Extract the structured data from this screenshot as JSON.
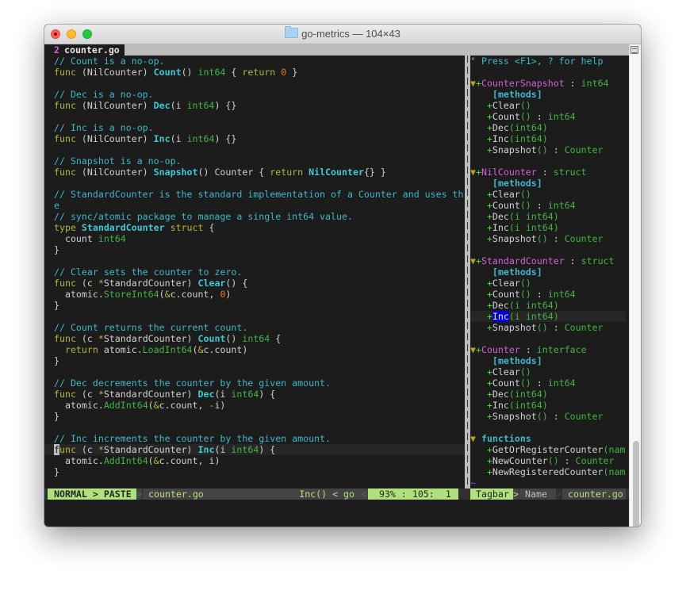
{
  "window": {
    "title": "go-metrics — 104×43",
    "folder_icon": "folder-icon"
  },
  "tabline": {
    "tab_number": "2",
    "tab_name": "counter.go"
  },
  "editor": {
    "lines": [
      [
        {
          "t": "// Count is a no-op.",
          "c": "c-comment"
        }
      ],
      [
        {
          "t": "func",
          "c": "c-kw"
        },
        {
          "t": " (NilCounter) ",
          "c": "c-text"
        },
        {
          "t": "Count",
          "c": "c-fn"
        },
        {
          "t": "() ",
          "c": "c-text"
        },
        {
          "t": "int64",
          "c": "c-type"
        },
        {
          "t": " { ",
          "c": "c-text"
        },
        {
          "t": "return",
          "c": "c-kw"
        },
        {
          "t": " ",
          "c": "c-text"
        },
        {
          "t": "0",
          "c": "c-num"
        },
        {
          "t": " }",
          "c": "c-text"
        }
      ],
      [],
      [
        {
          "t": "// Dec is a no-op.",
          "c": "c-comment"
        }
      ],
      [
        {
          "t": "func",
          "c": "c-kw"
        },
        {
          "t": " (NilCounter) ",
          "c": "c-text"
        },
        {
          "t": "Dec",
          "c": "c-fn"
        },
        {
          "t": "(i ",
          "c": "c-text"
        },
        {
          "t": "int64",
          "c": "c-type"
        },
        {
          "t": ") {}",
          "c": "c-text"
        }
      ],
      [],
      [
        {
          "t": "// Inc is a no-op.",
          "c": "c-comment"
        }
      ],
      [
        {
          "t": "func",
          "c": "c-kw"
        },
        {
          "t": " (NilCounter) ",
          "c": "c-text"
        },
        {
          "t": "Inc",
          "c": "c-fn"
        },
        {
          "t": "(i ",
          "c": "c-text"
        },
        {
          "t": "int64",
          "c": "c-type"
        },
        {
          "t": ") {}",
          "c": "c-text"
        }
      ],
      [],
      [
        {
          "t": "// Snapshot is a no-op.",
          "c": "c-comment"
        }
      ],
      [
        {
          "t": "func",
          "c": "c-kw"
        },
        {
          "t": " (NilCounter) ",
          "c": "c-text"
        },
        {
          "t": "Snapshot",
          "c": "c-fn"
        },
        {
          "t": "() Counter { ",
          "c": "c-text"
        },
        {
          "t": "return",
          "c": "c-kw"
        },
        {
          "t": " ",
          "c": "c-text"
        },
        {
          "t": "NilCounter",
          "c": "c-fn"
        },
        {
          "t": "{} }",
          "c": "c-text"
        }
      ],
      [],
      [
        {
          "t": "// StandardCounter is the standard implementation of a Counter and uses th",
          "c": "c-comment"
        }
      ],
      [
        {
          "t": "e",
          "c": "c-comment"
        }
      ],
      [
        {
          "t": "// sync/atomic package to manage a single int64 value.",
          "c": "c-comment"
        }
      ],
      [
        {
          "t": "type",
          "c": "c-kw"
        },
        {
          "t": " ",
          "c": "c-text"
        },
        {
          "t": "StandardCounter",
          "c": "c-fn"
        },
        {
          "t": " ",
          "c": "c-text"
        },
        {
          "t": "struct",
          "c": "c-kw"
        },
        {
          "t": " {",
          "c": "c-text"
        }
      ],
      [
        {
          "t": "  count ",
          "c": "c-text"
        },
        {
          "t": "int64",
          "c": "c-type"
        }
      ],
      [
        {
          "t": "}",
          "c": "c-text"
        }
      ],
      [],
      [
        {
          "t": "// Clear sets the counter to zero.",
          "c": "c-comment"
        }
      ],
      [
        {
          "t": "func",
          "c": "c-kw"
        },
        {
          "t": " (c ",
          "c": "c-text"
        },
        {
          "t": "*",
          "c": "c-ptr"
        },
        {
          "t": "StandardCounter) ",
          "c": "c-text"
        },
        {
          "t": "Clear",
          "c": "c-fn"
        },
        {
          "t": "() {",
          "c": "c-text"
        }
      ],
      [
        {
          "t": "  atomic.",
          "c": "c-text"
        },
        {
          "t": "StoreInt64",
          "c": "c-call"
        },
        {
          "t": "(",
          "c": "c-text"
        },
        {
          "t": "&",
          "c": "c-ptr"
        },
        {
          "t": "c.count, ",
          "c": "c-text"
        },
        {
          "t": "0",
          "c": "c-num"
        },
        {
          "t": ")",
          "c": "c-text"
        }
      ],
      [
        {
          "t": "}",
          "c": "c-text"
        }
      ],
      [],
      [
        {
          "t": "// Count returns the current count.",
          "c": "c-comment"
        }
      ],
      [
        {
          "t": "func",
          "c": "c-kw"
        },
        {
          "t": " (c ",
          "c": "c-text"
        },
        {
          "t": "*",
          "c": "c-ptr"
        },
        {
          "t": "StandardCounter) ",
          "c": "c-text"
        },
        {
          "t": "Count",
          "c": "c-fn"
        },
        {
          "t": "() ",
          "c": "c-text"
        },
        {
          "t": "int64",
          "c": "c-type"
        },
        {
          "t": " {",
          "c": "c-text"
        }
      ],
      [
        {
          "t": "  ",
          "c": "c-text"
        },
        {
          "t": "return",
          "c": "c-kw"
        },
        {
          "t": " atomic.",
          "c": "c-text"
        },
        {
          "t": "LoadInt64",
          "c": "c-call"
        },
        {
          "t": "(",
          "c": "c-text"
        },
        {
          "t": "&",
          "c": "c-ptr"
        },
        {
          "t": "c.count)",
          "c": "c-text"
        }
      ],
      [
        {
          "t": "}",
          "c": "c-text"
        }
      ],
      [],
      [
        {
          "t": "// Dec decrements the counter by the given amount.",
          "c": "c-comment"
        }
      ],
      [
        {
          "t": "func",
          "c": "c-kw"
        },
        {
          "t": " (c ",
          "c": "c-text"
        },
        {
          "t": "*",
          "c": "c-ptr"
        },
        {
          "t": "StandardCounter) ",
          "c": "c-text"
        },
        {
          "t": "Dec",
          "c": "c-fn"
        },
        {
          "t": "(i ",
          "c": "c-text"
        },
        {
          "t": "int64",
          "c": "c-type"
        },
        {
          "t": ") {",
          "c": "c-text"
        }
      ],
      [
        {
          "t": "  atomic.",
          "c": "c-text"
        },
        {
          "t": "AddInt64",
          "c": "c-call"
        },
        {
          "t": "(",
          "c": "c-text"
        },
        {
          "t": "&",
          "c": "c-ptr"
        },
        {
          "t": "c.count, ",
          "c": "c-text"
        },
        {
          "t": "-",
          "c": "c-ptr"
        },
        {
          "t": "i)",
          "c": "c-text"
        }
      ],
      [
        {
          "t": "}",
          "c": "c-text"
        }
      ],
      [],
      [
        {
          "t": "// Inc increments the counter by the given amount.",
          "c": "c-comment"
        }
      ],
      [
        {
          "t": "f",
          "c": "cursor-block"
        },
        {
          "t": "unc",
          "c": "c-kw"
        },
        {
          "t": " (c ",
          "c": "c-text"
        },
        {
          "t": "*",
          "c": "c-ptr"
        },
        {
          "t": "StandardCounter) ",
          "c": "c-text"
        },
        {
          "t": "Inc",
          "c": "c-fn"
        },
        {
          "t": "(i ",
          "c": "c-text"
        },
        {
          "t": "int64",
          "c": "c-type"
        },
        {
          "t": ") {",
          "c": "c-text"
        }
      ],
      [
        {
          "t": "  atomic.",
          "c": "c-text"
        },
        {
          "t": "AddInt64",
          "c": "c-call"
        },
        {
          "t": "(",
          "c": "c-text"
        },
        {
          "t": "&",
          "c": "c-ptr"
        },
        {
          "t": "c.count, i)",
          "c": "c-text"
        }
      ],
      [
        {
          "t": "}",
          "c": "c-text"
        }
      ]
    ],
    "cursor_line_index": 35
  },
  "tagbar": {
    "lines": [
      [
        {
          "t": "\" Press <F1>, ? for help",
          "c": "t-help"
        }
      ],
      [],
      [
        {
          "t": "▼",
          "c": "t-fold"
        },
        {
          "t": "+",
          "c": "t-plus"
        },
        {
          "t": "CounterSnapshot",
          "c": "t-scope"
        },
        {
          "t": " : ",
          "c": "t-name"
        },
        {
          "t": "int64",
          "c": "t-sig"
        }
      ],
      [
        {
          "t": "    [methods]",
          "c": "t-kind"
        }
      ],
      [
        {
          "t": "   +",
          "c": "t-plus"
        },
        {
          "t": "Clear",
          "c": "t-name"
        },
        {
          "t": "()",
          "c": "t-sig"
        }
      ],
      [
        {
          "t": "   +",
          "c": "t-plus"
        },
        {
          "t": "Count",
          "c": "t-name"
        },
        {
          "t": "()",
          "c": "t-sig"
        },
        {
          "t": " : ",
          "c": "t-name"
        },
        {
          "t": "int64",
          "c": "t-sig"
        }
      ],
      [
        {
          "t": "   +",
          "c": "t-plus"
        },
        {
          "t": "Dec",
          "c": "t-name"
        },
        {
          "t": "(int64)",
          "c": "t-sig"
        }
      ],
      [
        {
          "t": "   +",
          "c": "t-plus"
        },
        {
          "t": "Inc",
          "c": "t-name"
        },
        {
          "t": "(int64)",
          "c": "t-sig"
        }
      ],
      [
        {
          "t": "   +",
          "c": "t-plus"
        },
        {
          "t": "Snapshot",
          "c": "t-name"
        },
        {
          "t": "()",
          "c": "t-sig"
        },
        {
          "t": " : ",
          "c": "t-name"
        },
        {
          "t": "Counter",
          "c": "t-sig"
        }
      ],
      [],
      [
        {
          "t": "▼",
          "c": "t-fold"
        },
        {
          "t": "+",
          "c": "t-plus"
        },
        {
          "t": "NilCounter",
          "c": "t-scope"
        },
        {
          "t": " : ",
          "c": "t-name"
        },
        {
          "t": "struct",
          "c": "t-sig"
        }
      ],
      [
        {
          "t": "    [methods]",
          "c": "t-kind"
        }
      ],
      [
        {
          "t": "   +",
          "c": "t-plus"
        },
        {
          "t": "Clear",
          "c": "t-name"
        },
        {
          "t": "()",
          "c": "t-sig"
        }
      ],
      [
        {
          "t": "   +",
          "c": "t-plus"
        },
        {
          "t": "Count",
          "c": "t-name"
        },
        {
          "t": "()",
          "c": "t-sig"
        },
        {
          "t": " : ",
          "c": "t-name"
        },
        {
          "t": "int64",
          "c": "t-sig"
        }
      ],
      [
        {
          "t": "   +",
          "c": "t-plus"
        },
        {
          "t": "Dec",
          "c": "t-name"
        },
        {
          "t": "(i int64)",
          "c": "t-sig"
        }
      ],
      [
        {
          "t": "   +",
          "c": "t-plus"
        },
        {
          "t": "Inc",
          "c": "t-name"
        },
        {
          "t": "(i int64)",
          "c": "t-sig"
        }
      ],
      [
        {
          "t": "   +",
          "c": "t-plus"
        },
        {
          "t": "Snapshot",
          "c": "t-name"
        },
        {
          "t": "()",
          "c": "t-sig"
        },
        {
          "t": " : ",
          "c": "t-name"
        },
        {
          "t": "Counter",
          "c": "t-sig"
        }
      ],
      [],
      [
        {
          "t": "▼",
          "c": "t-fold"
        },
        {
          "t": "+",
          "c": "t-plus"
        },
        {
          "t": "StandardCounter",
          "c": "t-scope"
        },
        {
          "t": " : ",
          "c": "t-name"
        },
        {
          "t": "struct",
          "c": "t-sig"
        }
      ],
      [
        {
          "t": "    [methods]",
          "c": "t-kind"
        }
      ],
      [
        {
          "t": "   +",
          "c": "t-plus"
        },
        {
          "t": "Clear",
          "c": "t-name"
        },
        {
          "t": "()",
          "c": "t-sig"
        }
      ],
      [
        {
          "t": "   +",
          "c": "t-plus"
        },
        {
          "t": "Count",
          "c": "t-name"
        },
        {
          "t": "()",
          "c": "t-sig"
        },
        {
          "t": " : ",
          "c": "t-name"
        },
        {
          "t": "int64",
          "c": "t-sig"
        }
      ],
      [
        {
          "t": "   +",
          "c": "t-plus"
        },
        {
          "t": "Dec",
          "c": "t-name"
        },
        {
          "t": "(i int64)",
          "c": "t-sig"
        }
      ],
      [
        {
          "t": "   +",
          "c": "t-plus"
        },
        {
          "t": "Inc",
          "c": "t-sel"
        },
        {
          "t": "(i int64)",
          "c": "t-sig"
        }
      ],
      [
        {
          "t": "   +",
          "c": "t-plus"
        },
        {
          "t": "Snapshot",
          "c": "t-name"
        },
        {
          "t": "()",
          "c": "t-sig"
        },
        {
          "t": " : ",
          "c": "t-name"
        },
        {
          "t": "Counter",
          "c": "t-sig"
        }
      ],
      [],
      [
        {
          "t": "▼",
          "c": "t-fold"
        },
        {
          "t": "+",
          "c": "t-plus"
        },
        {
          "t": "Counter",
          "c": "t-scope"
        },
        {
          "t": " : ",
          "c": "t-name"
        },
        {
          "t": "interface",
          "c": "t-sig"
        }
      ],
      [
        {
          "t": "    [methods]",
          "c": "t-kind"
        }
      ],
      [
        {
          "t": "   +",
          "c": "t-plus"
        },
        {
          "t": "Clear",
          "c": "t-name"
        },
        {
          "t": "()",
          "c": "t-sig"
        }
      ],
      [
        {
          "t": "   +",
          "c": "t-plus"
        },
        {
          "t": "Count",
          "c": "t-name"
        },
        {
          "t": "()",
          "c": "t-sig"
        },
        {
          "t": " : ",
          "c": "t-name"
        },
        {
          "t": "int64",
          "c": "t-sig"
        }
      ],
      [
        {
          "t": "   +",
          "c": "t-plus"
        },
        {
          "t": "Dec",
          "c": "t-name"
        },
        {
          "t": "(int64)",
          "c": "t-sig"
        }
      ],
      [
        {
          "t": "   +",
          "c": "t-plus"
        },
        {
          "t": "Inc",
          "c": "t-name"
        },
        {
          "t": "(int64)",
          "c": "t-sig"
        }
      ],
      [
        {
          "t": "   +",
          "c": "t-plus"
        },
        {
          "t": "Snapshot",
          "c": "t-name"
        },
        {
          "t": "()",
          "c": "t-sig"
        },
        {
          "t": " : ",
          "c": "t-name"
        },
        {
          "t": "Counter",
          "c": "t-sig"
        }
      ],
      [],
      [
        {
          "t": "▼",
          "c": "t-fold"
        },
        {
          "t": " functions",
          "c": "t-kind"
        }
      ],
      [
        {
          "t": "   +",
          "c": "t-plus"
        },
        {
          "t": "GetOrRegisterCounter",
          "c": "t-name"
        },
        {
          "t": "(nam",
          "c": "t-sig"
        }
      ],
      [
        {
          "t": "   +",
          "c": "t-plus"
        },
        {
          "t": "NewCounter",
          "c": "t-name"
        },
        {
          "t": "()",
          "c": "t-sig"
        },
        {
          "t": " : ",
          "c": "t-name"
        },
        {
          "t": "Counter",
          "c": "t-sig"
        }
      ],
      [
        {
          "t": "   +",
          "c": "t-plus"
        },
        {
          "t": "NewRegisteredCounter",
          "c": "t-name"
        },
        {
          "t": "(nam",
          "c": "t-sig"
        }
      ],
      [
        {
          "t": "~",
          "c": "t-tilde"
        }
      ]
    ],
    "cursor_line_index": 23
  },
  "statusline": {
    "mode": "NORMAL > PASTE ",
    "sep1": ">",
    "filename": " counter.go",
    "tag": "Inc() < go ",
    "sep2": "<",
    "position": "  93% : 105:  1 ",
    "tagbar_label": " Tagbar ",
    "tagbar_sep": ">",
    "tagbar_sort": " Name ",
    "tagbar_sep2": ">",
    "tagbar_file": " counter.go "
  }
}
